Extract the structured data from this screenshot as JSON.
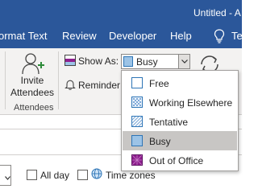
{
  "window": {
    "title": "Untitled  -  A"
  },
  "tabs": [
    {
      "label": "ormat Text"
    },
    {
      "label": "Review"
    },
    {
      "label": "Developer"
    },
    {
      "label": "Help"
    }
  ],
  "tell_me": {
    "label": "Te",
    "icon": "lightbulb-icon"
  },
  "ribbon": {
    "invite": {
      "label_line1": "Invite",
      "label_line2": "Attendees",
      "icon": "invite-attendees-icon"
    },
    "group_label": "Attendees",
    "show_as": {
      "label": "Show As:",
      "value": "Busy",
      "icon": "show-as-icon"
    },
    "reminder": {
      "label": "Reminder:",
      "icon": "bell-icon"
    },
    "recurrence": {
      "icon": "recurrence-icon"
    }
  },
  "form": {
    "all_day": {
      "label": "All day",
      "checked": false
    },
    "time_zones": {
      "label": "Time zones",
      "checked": false,
      "icon": "globe-icon"
    }
  },
  "dropdown": {
    "options": [
      {
        "label": "Free",
        "swatch": "free"
      },
      {
        "label": "Working Elsewhere",
        "swatch": "working-elsewhere"
      },
      {
        "label": "Tentative",
        "swatch": "tentative"
      },
      {
        "label": "Busy",
        "swatch": "busy"
      },
      {
        "label": "Out of Office",
        "swatch": "out-of-office"
      }
    ],
    "selected": "Busy"
  },
  "colors": {
    "brand": "#2b579a",
    "busy": "#9cc3e6",
    "out_of_office": "#8e1f8e",
    "selected_row": "#c8c6c4"
  }
}
